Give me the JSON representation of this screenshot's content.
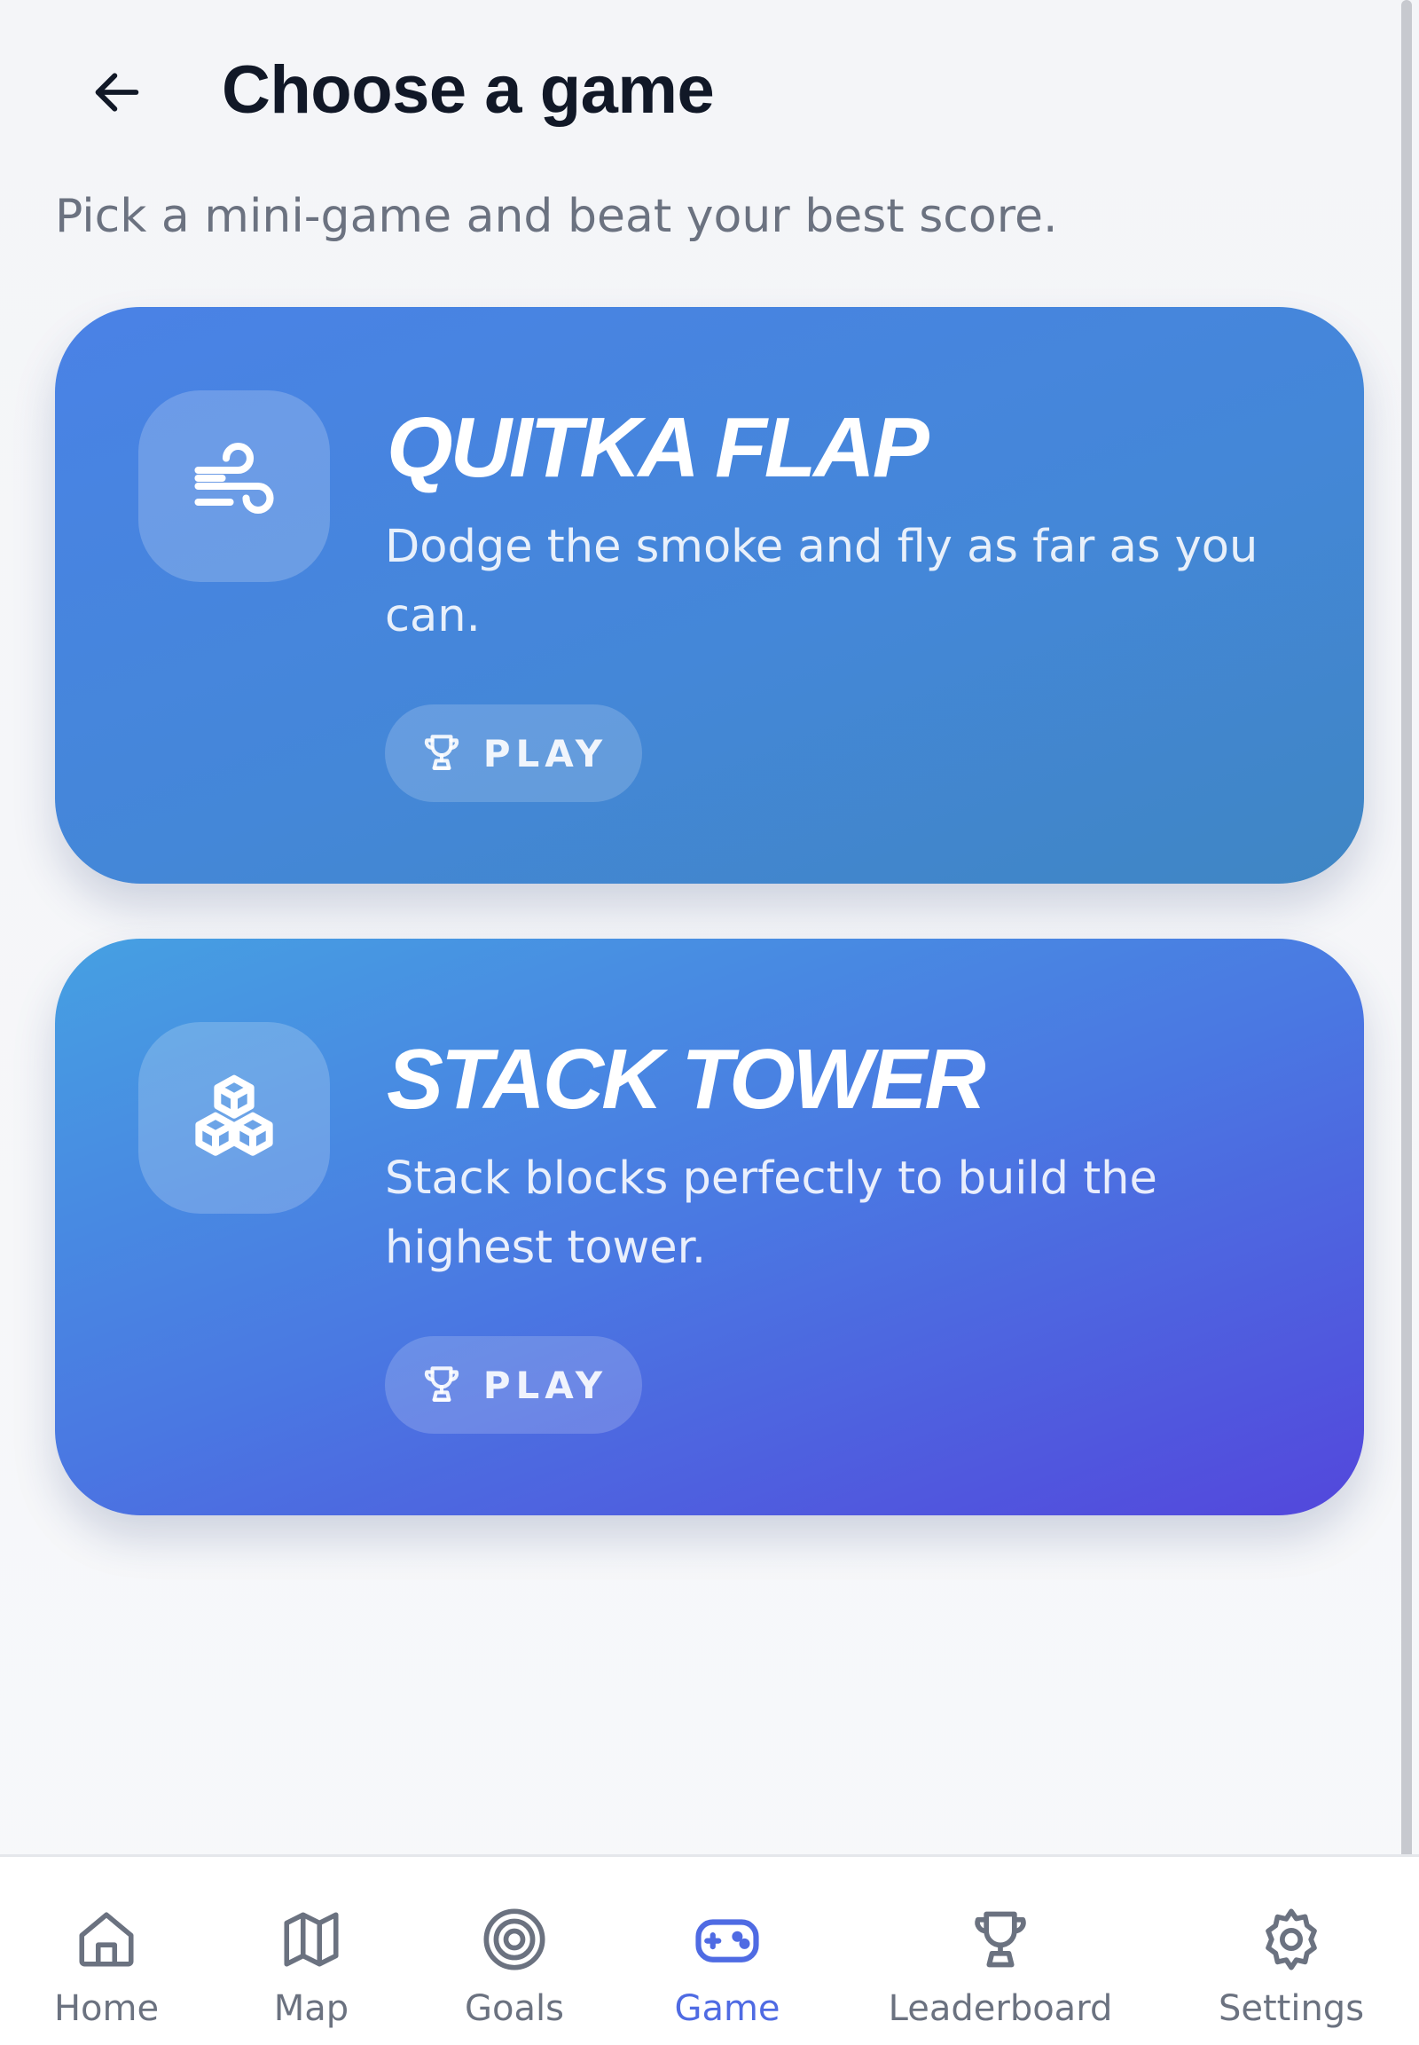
{
  "header": {
    "title": "Choose a game",
    "subtitle": "Pick a mini-game and beat your best score."
  },
  "games": [
    {
      "title": "QUITKA FLAP",
      "description": "Dodge the smoke and fly as far as you can.",
      "icon": "wind-icon",
      "play_label": "PLAY"
    },
    {
      "title": "STACK TOWER",
      "description": "Stack blocks perfectly to build the highest tower.",
      "icon": "cubes-icon",
      "play_label": "PLAY"
    }
  ],
  "nav": {
    "items": [
      {
        "label": "Home",
        "icon": "home-icon"
      },
      {
        "label": "Map",
        "icon": "map-icon"
      },
      {
        "label": "Goals",
        "icon": "target-icon"
      },
      {
        "label": "Game",
        "icon": "gamepad-icon",
        "active": true
      },
      {
        "label": "Leaderboard",
        "icon": "trophy-icon"
      },
      {
        "label": "Settings",
        "icon": "gear-icon"
      }
    ]
  },
  "colors": {
    "accent": "#4f6be3",
    "title_text": "#111827",
    "muted_text": "#6b7280"
  }
}
